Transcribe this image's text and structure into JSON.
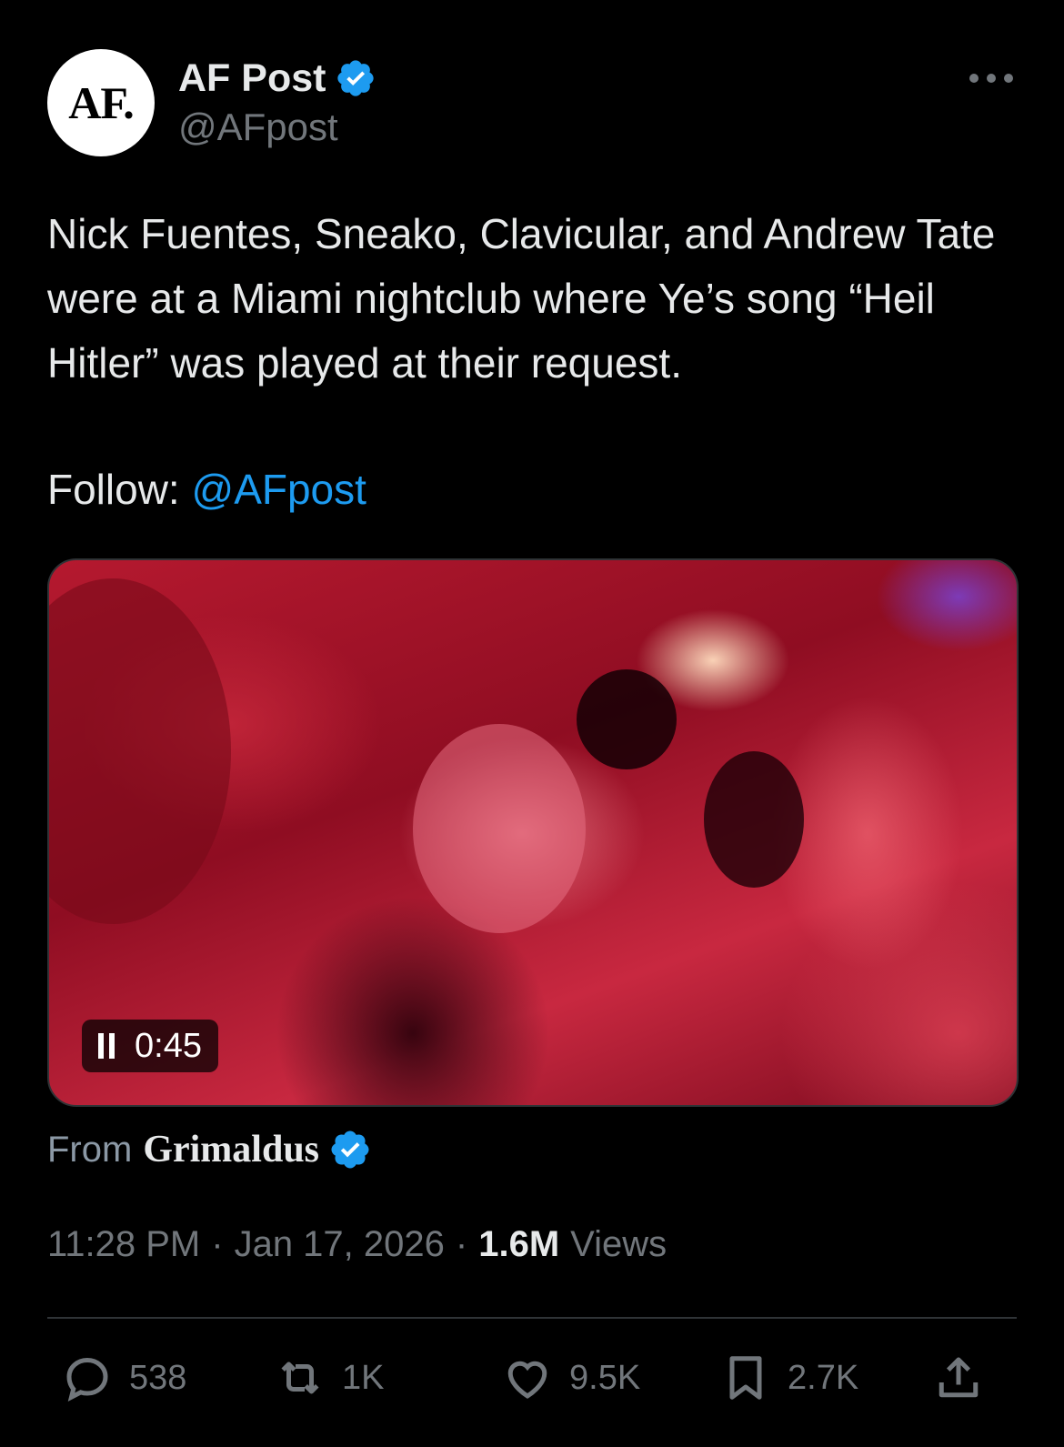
{
  "author": {
    "avatar_text": "AF.",
    "display_name": "AF Post",
    "handle": "@AFpost"
  },
  "tweet": {
    "text": "Nick Fuentes, Sneako, Clavicular, and Andrew Tate were at a Miami nightclub where Ye’s song “Heil Hitler” was played at their request.",
    "follow_label": "Follow:",
    "follow_mention": "@AFpost"
  },
  "media": {
    "duration": "0:45",
    "state_icon": "pause-icon"
  },
  "source": {
    "from_label": "From",
    "name": "Grimaldus"
  },
  "meta": {
    "time": "11:28 PM",
    "date": "Jan 17, 2026",
    "views_count": "1.6M",
    "views_label": "Views",
    "separator": "·"
  },
  "actions": {
    "replies": "538",
    "reposts": "1K",
    "likes": "9.5K",
    "bookmarks": "2.7K"
  },
  "colors": {
    "background": "#000000",
    "text": "#e7e9ea",
    "muted": "#71767b",
    "accent": "#1d9bf0",
    "divider": "#2f3336"
  }
}
